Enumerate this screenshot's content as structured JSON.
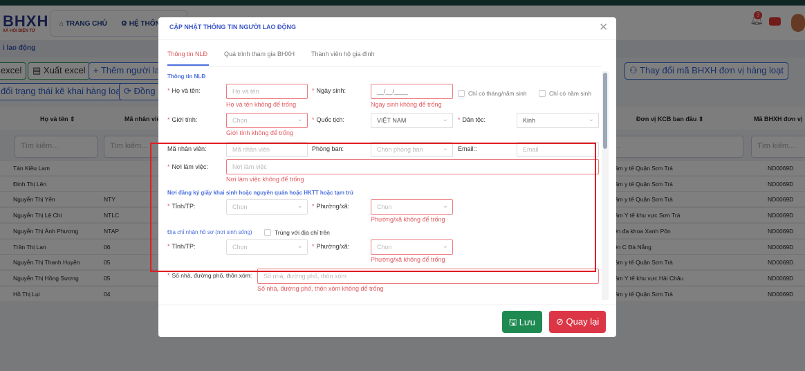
{
  "app": {
    "logo": "BHXH",
    "logo_sub": "XÃ HỘI ĐIỆN TỬ",
    "nav": [
      "TRANG CHỦ",
      "HỆ THỐNG"
    ],
    "notification_count": "3",
    "breadcrumb": "i lao động"
  },
  "toolbar": {
    "row1": [
      "excel",
      "Xuất excel",
      "+ Thêm người lao",
      "Thay đổi mã BHXH đơn vị hàng loạt"
    ],
    "row2": [
      "đổi trạng thái kê khai hàng loạt",
      "Đồng b"
    ]
  },
  "table": {
    "headers": [
      "Họ và tên",
      "Mã nhân viên",
      "Đơn vị KCB ban đầu",
      "Mã BHXH đơn vị"
    ],
    "search_placeholder": "Tìm kiếm...",
    "search_placeholder_short": "Tìm kiếm...",
    "search_placeholder_right": "m...",
    "rows": [
      {
        "name": "Tán Kiều Lam",
        "code": "",
        "kcb": "ung tâm y tế Quận Sơn Trà",
        "bhxh": "ND0069D"
      },
      {
        "name": "Đinh Thị Lên",
        "code": "",
        "kcb": "ung tâm y tế Quận Sơn Trà",
        "bhxh": "ND0069D"
      },
      {
        "name": "Nguyễn Thị Yến",
        "code": "NTY",
        "kcb": "ung tâm y tế Quận Sơn Trà",
        "bhxh": "ND0069D"
      },
      {
        "name": "Nguyễn Thị Lệ Chi",
        "code": "NTLC",
        "kcb": "ung tâm Y tế khu vực Sơn Trà",
        "bhxh": "ND0069D"
      },
      {
        "name": "Nguyễn Thị Ánh Phương",
        "code": "NTAP",
        "kcb": "nh viện đa khoa Xanh Pôn",
        "bhxh": "ND0069D"
      },
      {
        "name": "Trần Thị Lan",
        "code": "06",
        "kcb": "nh viện C Đà Nẵng",
        "bhxh": "ND0069D"
      },
      {
        "name": "Nguyễn Thị Thanh Huyền",
        "code": "05",
        "kcb": "ung tâm y tế Quận Sơn Trà",
        "bhxh": "ND0069D"
      },
      {
        "name": "Nguyễn Thị Hồng Sương",
        "code": "05",
        "kcb": "ung tâm Y tế khu vực Hải Châu",
        "bhxh": "ND0069D"
      },
      {
        "name": "Hồ Thị Lụi",
        "code": "04",
        "kcb": "ung tâm y tế Quận Sơn Trà",
        "bhxh": "ND0069D"
      }
    ]
  },
  "modal": {
    "title": "CẬP NHẬT THÔNG TIN NGƯỜI LAO ĐỘNG",
    "tabs": [
      "Thông tin NLĐ",
      "Quá trình tham gia BHXH",
      "Thành viên hộ gia đình"
    ],
    "section1": "Thông tin NLĐ",
    "ho_ten": {
      "label": "Họ và tên:",
      "placeholder": "Họ và tên",
      "error": "Họ và tên không để trống"
    },
    "ngay_sinh": {
      "label": "Ngày sinh:",
      "placeholder": "__/__/____",
      "error": "Ngày sinh không để trống"
    },
    "chk_thang_nam": "Chỉ có tháng/năm sinh",
    "chk_nam": "Chỉ có năm sinh",
    "gioi_tinh": {
      "label": "Giới tính:",
      "placeholder": "Chọn",
      "error": "Giới tính không để trống"
    },
    "quoc_tich": {
      "label": "Quốc tịch:",
      "value": "VIỆT NAM"
    },
    "dan_toc": {
      "label": "Dân tộc:",
      "value": "Kinh"
    },
    "ma_nv": {
      "label": "Mã nhân viên:",
      "placeholder": "Mã nhân viên"
    },
    "phong_ban": {
      "label": "Phòng ban:",
      "placeholder": "Chọn phòng ban"
    },
    "email": {
      "label": "Email::",
      "placeholder": "Email"
    },
    "noi_lam_viec": {
      "label": "Nơi làm việc:",
      "placeholder": "Nơi làm việc",
      "error": "Nơi làm việc không để trống"
    },
    "section2": "Nơi đăng ký giấy khai sinh hoặc nguyên quán hoặc HKTT hoặc tạm trú",
    "tinh1": {
      "label": "Tỉnh/TP:",
      "placeholder": "Chọn"
    },
    "xa1": {
      "label": "Phường/xã:",
      "placeholder": "Chọn",
      "error": "Phường/xã không để trống"
    },
    "section3": "Địa chỉ nhận hồ sơ (nơi sinh sống)",
    "chk_trung": "Trùng với địa chỉ trên",
    "tinh2": {
      "label": "Tỉnh/TP:",
      "placeholder": "Chọn"
    },
    "xa2": {
      "label": "Phường/xã:",
      "placeholder": "Chọn",
      "error": "Phường/xã không để trống"
    },
    "so_nha": {
      "label": "Số nhà, đường phố, thôn xóm:",
      "placeholder": "Số nhà, đường phố, thôn xóm",
      "error": "Số nhà, đường phố, thôn xóm không để trống"
    },
    "save": "Lưu",
    "back": "Quay lại"
  }
}
